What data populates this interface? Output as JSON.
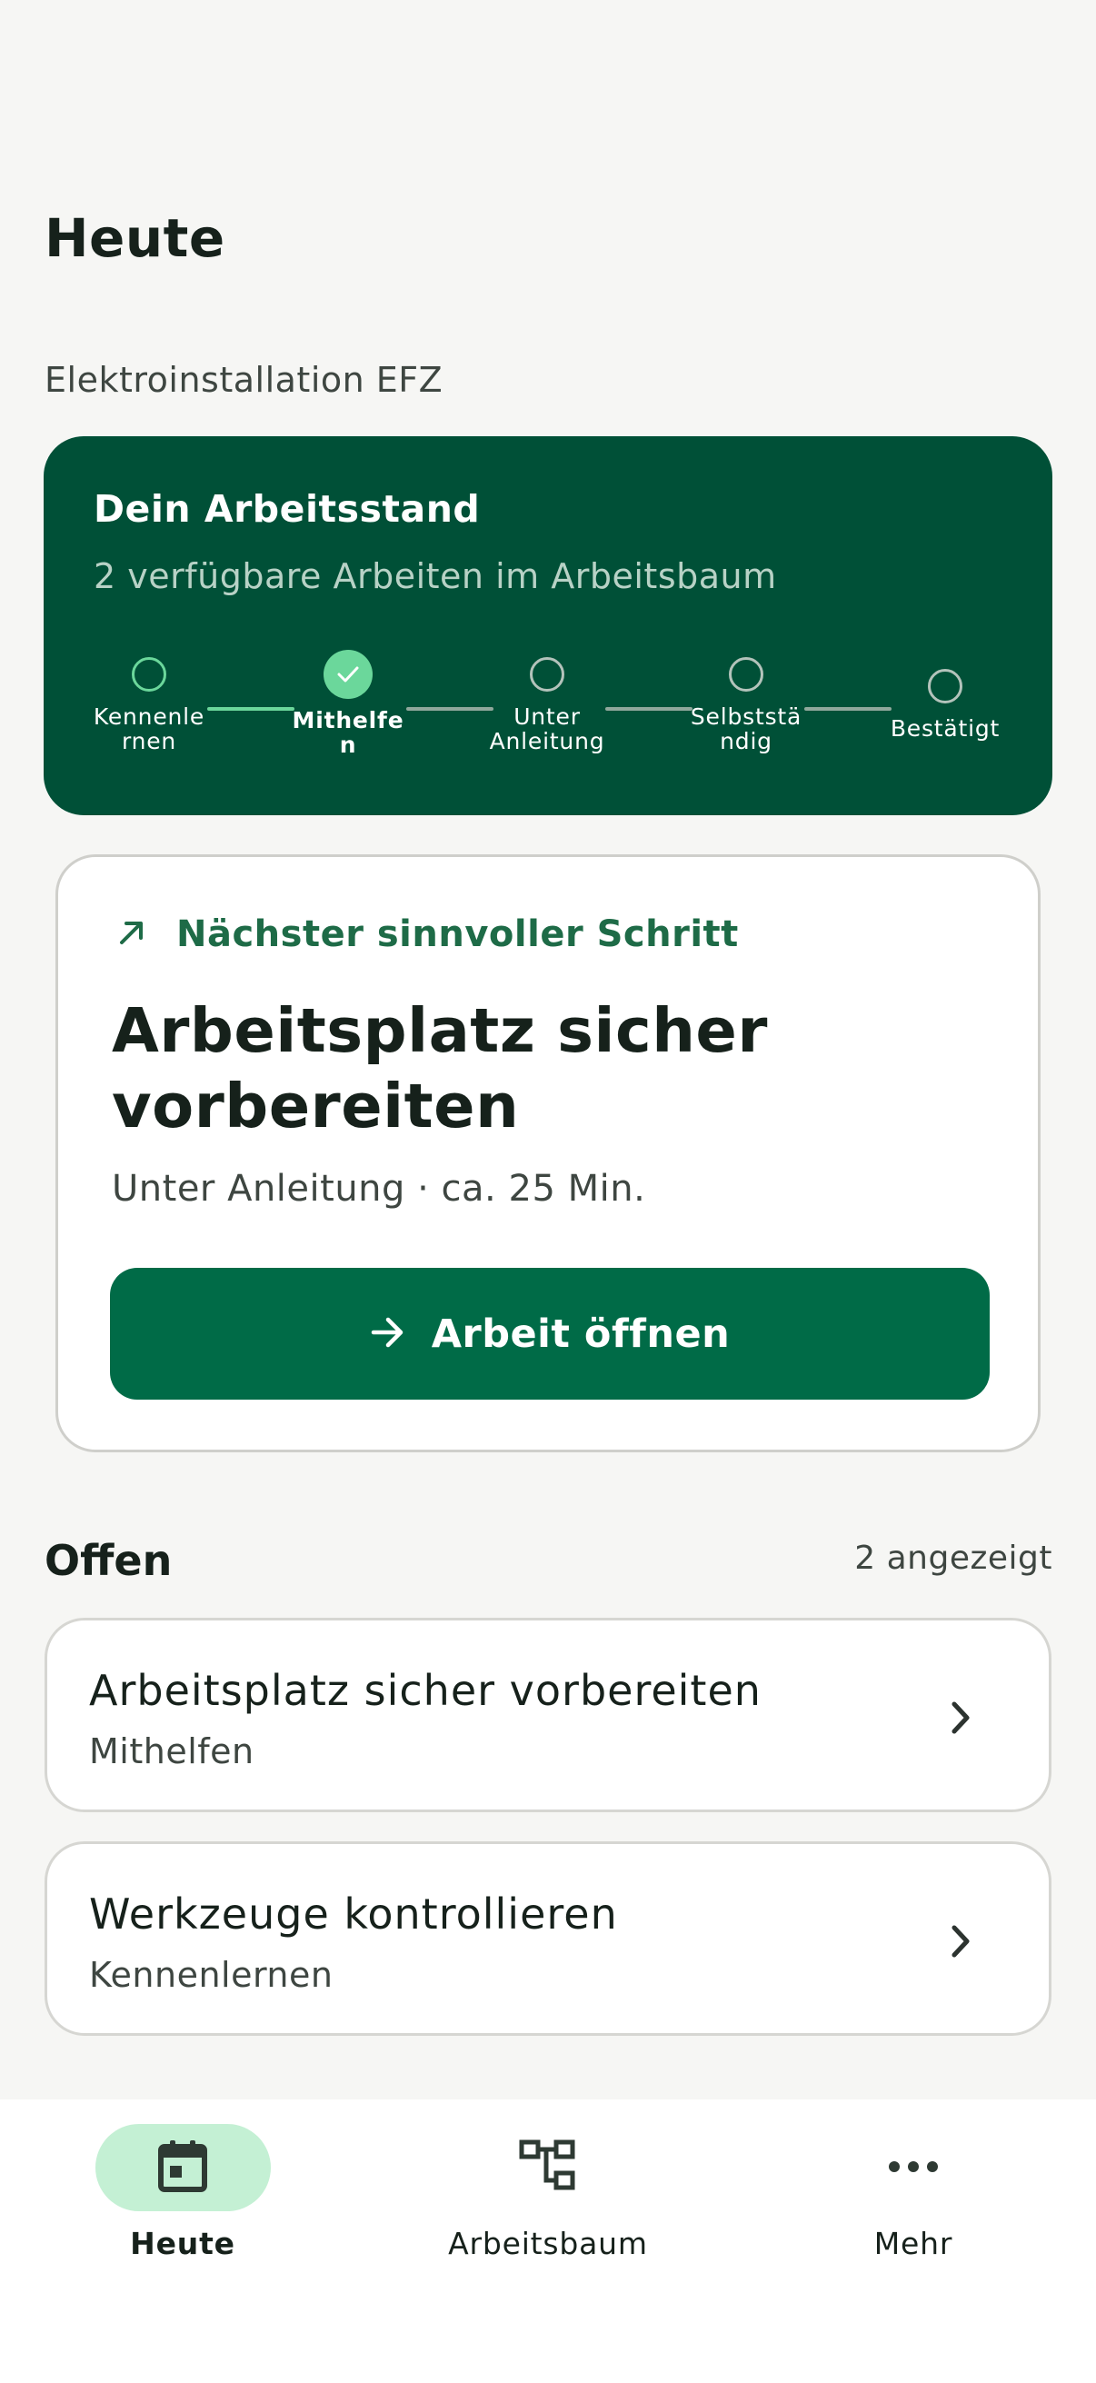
{
  "header": {
    "title": "Heute",
    "program": "Elektroinstallation EFZ"
  },
  "status_card": {
    "title": "Dein Arbeitsstand",
    "subtitle": "2 verfügbare Arbeiten im Arbeitsbaum",
    "steps": [
      {
        "label": "Kennenlernen",
        "state": "active"
      },
      {
        "label": "Mithelfen",
        "state": "done"
      },
      {
        "label": "Unter Anleitung",
        "state": "pending"
      },
      {
        "label": "Selbstständig",
        "state": "pending"
      },
      {
        "label": "Bestätigt",
        "state": "pending"
      }
    ]
  },
  "next_step": {
    "eyebrow": "Nächster sinnvoller Schritt",
    "eyebrow_icon": "arrow-up-right-icon",
    "title": "Arbeitsplatz sicher vorbereiten",
    "meta": "Unter Anleitung · ca. 25 Min.",
    "button_label": "Arbeit öffnen",
    "button_icon": "arrow-right-icon"
  },
  "open_section": {
    "title": "Offen",
    "count_label": "2 angezeigt",
    "items": [
      {
        "title": "Arbeitsplatz sicher vorbereiten",
        "subtitle": "Mithelfen"
      },
      {
        "title": "Werkzeuge kontrollieren",
        "subtitle": "Kennenlernen"
      }
    ]
  },
  "bottom_nav": {
    "items": [
      {
        "label": "Heute",
        "icon": "calendar-icon",
        "active": true
      },
      {
        "label": "Arbeitsbaum",
        "icon": "tree-icon",
        "active": false
      },
      {
        "label": "Mehr",
        "icon": "more-icon",
        "active": false
      }
    ]
  },
  "colors": {
    "background": "#F6F6F4",
    "brand_dark": "#005037",
    "brand_button": "#006B47",
    "accent_green": "#6BD79B",
    "nav_active_pill": "#C4F0D4"
  }
}
